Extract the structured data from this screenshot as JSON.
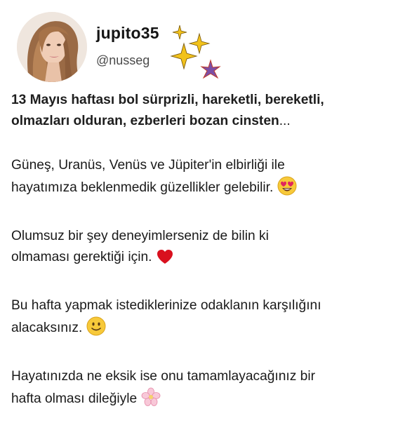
{
  "profile": {
    "username": "jupito35",
    "handle": "@nusseg",
    "avatar_icon": "woman-portrait-avatar",
    "decoration_icons": [
      "sparkle-star-icon",
      "purple-star-icon"
    ]
  },
  "post": {
    "headline_line1": "13 Mayıs haftası bol sürprizli, hareketli, bereketli,",
    "headline_line2": "olmazları olduran, ezberleri bozan cinsten",
    "headline_ellipsis": "...",
    "p1_line1": "Güneş, Uranüs, Venüs ve Jüpiter'in elbirliği ile",
    "p1_line2": "hayatımıza beklenmedik güzellikler gelebilir.",
    "p2_line1": "Olumsuz bir şey deneyimlerseniz de bilin ki",
    "p2_line2": "olmaması gerektiği için.",
    "p3_line1": "Bu hafta yapmak istediklerinize odaklanın karşılığını",
    "p3_line2": "alacaksınız.",
    "p4_line1": "Hayatınızda ne eksik ise onu tamamlayacağınız bir",
    "p4_line2": "hafta olması dileğiyle",
    "emoji_icons": [
      "heart-eyes-emoji-icon",
      "red-heart-icon",
      "smiley-emoji-icon",
      "cherry-blossom-icon"
    ]
  },
  "colors": {
    "sparkle": "#f2c21b",
    "star": "#7b4fa6",
    "heart": "#d9101e",
    "emoji_face": "#f7c93a"
  }
}
